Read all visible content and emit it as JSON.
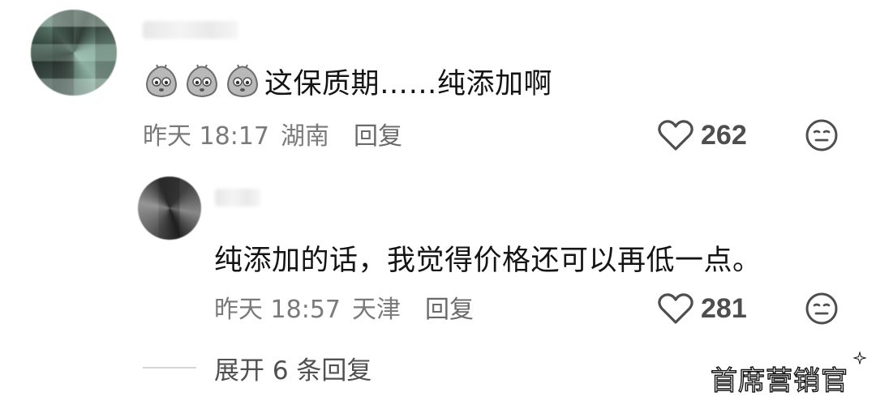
{
  "comment": {
    "text": "这保质期……纯添加啊",
    "emoji_icon": "potato-emoji-icon",
    "emoji_count": 3,
    "meta": {
      "time": "昨天 18:17",
      "location": "湖南",
      "reply_label": "回复"
    },
    "likes": "262"
  },
  "reply": {
    "text": "纯添加的话，我觉得价格还可以再低一点。",
    "meta": {
      "time": "昨天 18:57",
      "location": "天津",
      "reply_label": "回复"
    },
    "likes": "281"
  },
  "expand_replies": "展开 6 条回复",
  "watermark": "首席营销官",
  "icons": {
    "like": "heart-outline-icon",
    "dislike": "meh-face-icon"
  },
  "colors": {
    "text_primary": "#141414",
    "text_meta": "#7a7a7a",
    "icon": "#4e4e4e"
  }
}
